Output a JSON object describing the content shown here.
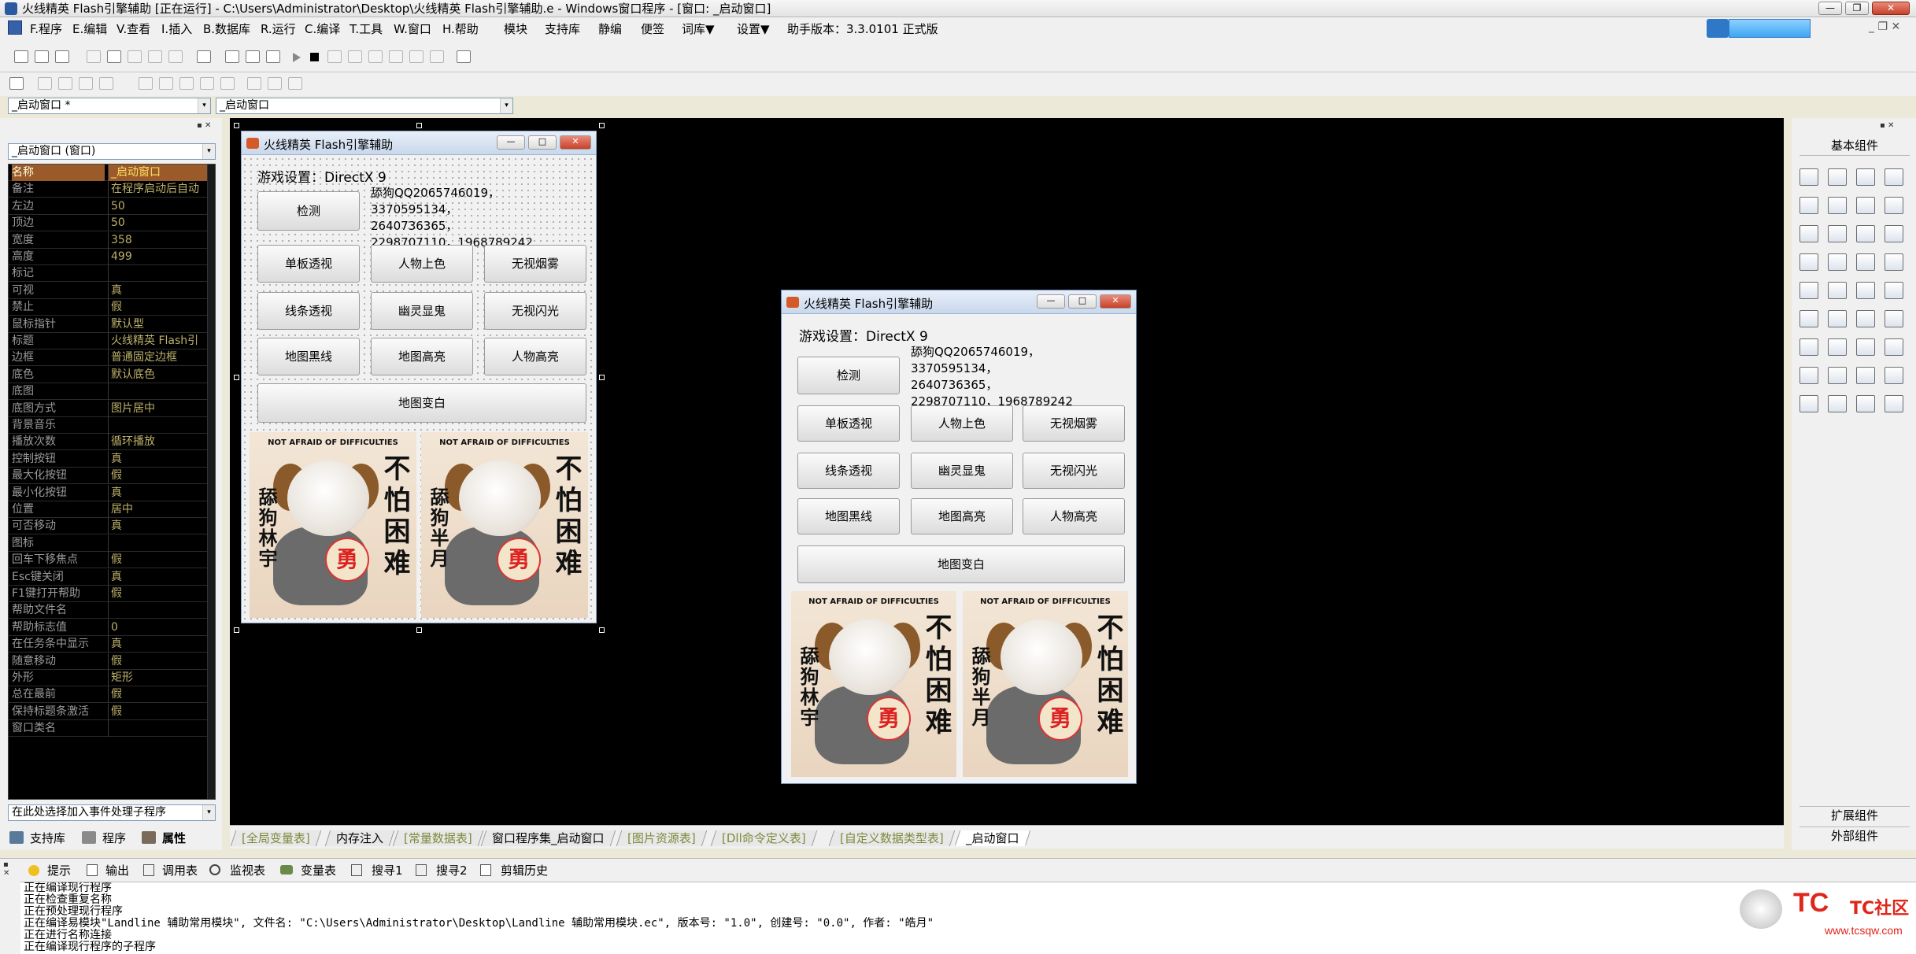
{
  "window": {
    "title": "火线精英 Flash引擎辅助 [正在运行] - C:\\Users\\Administrator\\Desktop\\火线精英 Flash引擎辅助.e - Windows窗口程序 - [窗口: _启动窗口]",
    "btn_min": "—",
    "btn_max": "❐",
    "btn_close": "✕"
  },
  "menu": [
    "F.程序",
    "E.编辑",
    "V.查看",
    "I.插入",
    "B.数据库",
    "R.运行",
    "C.编译",
    "T.工具",
    "W.窗口",
    "H.帮助",
    "模块",
    "支持库",
    "静编",
    "便签",
    "词库▼",
    "设置▼",
    "助手版本：3.3.0101 正式版"
  ],
  "toolbar": {
    "combo_window": "_启动窗口 *",
    "combo_sub": "_启动窗口",
    "dd_arrow": "▾"
  },
  "left_panel": {
    "combo_object": "_启动窗口 (窗口)",
    "properties": [
      {
        "k": "名称",
        "v": "_启动窗口"
      },
      {
        "k": "备注",
        "v": "在程序启动后自动"
      },
      {
        "k": "左边",
        "v": "50"
      },
      {
        "k": "顶边",
        "v": "50"
      },
      {
        "k": "宽度",
        "v": "358"
      },
      {
        "k": "高度",
        "v": "499"
      },
      {
        "k": "标记",
        "v": ""
      },
      {
        "k": "可视",
        "v": "真"
      },
      {
        "k": "禁止",
        "v": "假"
      },
      {
        "k": "鼠标指针",
        "v": "默认型"
      },
      {
        "k": "标题",
        "v": "火线精英 Flash引"
      },
      {
        "k": "边框",
        "v": "普通固定边框"
      },
      {
        "k": "底色",
        "v": "默认底色"
      },
      {
        "k": "底图",
        "v": ""
      },
      {
        "k": "  底图方式",
        "v": "图片居中"
      },
      {
        "k": "背景音乐",
        "v": ""
      },
      {
        "k": "  播放次数",
        "v": "循环播放"
      },
      {
        "k": "控制按钮",
        "v": "真"
      },
      {
        "k": "  最大化按钮",
        "v": "假"
      },
      {
        "k": "  最小化按钮",
        "v": "真"
      },
      {
        "k": "位置",
        "v": "居中"
      },
      {
        "k": "可否移动",
        "v": "真"
      },
      {
        "k": "图标",
        "v": ""
      },
      {
        "k": "回车下移焦点",
        "v": "假"
      },
      {
        "k": "Esc键关闭",
        "v": "真"
      },
      {
        "k": "F1键打开帮助",
        "v": "假"
      },
      {
        "k": "  帮助文件名",
        "v": ""
      },
      {
        "k": "  帮助标志值",
        "v": "0"
      },
      {
        "k": "在任务条中显示",
        "v": "真"
      },
      {
        "k": "随意移动",
        "v": "假"
      },
      {
        "k": "外形",
        "v": "矩形"
      },
      {
        "k": "总在最前",
        "v": "假"
      },
      {
        "k": "保持标题条激活",
        "v": "假"
      },
      {
        "k": "窗口类名",
        "v": ""
      }
    ],
    "event_combo": "在此处选择加入事件处理子程序",
    "bottom_tabs": [
      "支持库",
      "程序",
      "属性"
    ]
  },
  "app_window": {
    "caption": "火线精英 Flash引擎辅助",
    "game_setting": "游戏设置：DirectX 9",
    "qq_text": "舔狗QQ2065746019，3370595134，2640736365，2298707110，1968789242",
    "btn_detect": "检测",
    "buttons": [
      "单板透视",
      "人物上色",
      "无视烟雾",
      "线条透视",
      "幽灵显鬼",
      "无视闪光",
      "地图黑线",
      "地图高亮",
      "人物高亮"
    ],
    "btn_map_white": "地图变白",
    "img_arc": "NOT AFRAID OF DIFFICULTIES",
    "img_badge": "勇",
    "img_slogan": "不怕困难",
    "img_name_left": "舔狗林宇",
    "img_name_right": "舔狗半月",
    "btn_min": "—",
    "btn_max": "□",
    "btn_close": "✕"
  },
  "right_panel": {
    "title": "基本组件",
    "ext": "扩展组件",
    "external": "外部组件"
  },
  "editor_tabs": [
    "[全局变量表]",
    "内存注入",
    "[常量数据表]",
    "窗口程序集_启动窗口",
    "[图片资源表]",
    "[Dll命令定义表]",
    "[自定义数据类型表]",
    "_启动窗口"
  ],
  "output_tabs": [
    "提示",
    "输出",
    "调用表",
    "监视表",
    "变量表",
    "搜寻1",
    "搜寻2",
    "剪辑历史"
  ],
  "output_lines": [
    "正在编译现行程序",
    "正在检查重复名称",
    "正在预处理现行程序",
    "正在编译易模块\"Landline 辅助常用模块\", 文件名: \"C:\\Users\\Administrator\\Desktop\\Landline 辅助常用模块.ec\", 版本号: \"1.0\", 创建号: \"0.0\", 作者: \"皓月\"",
    "正在进行名称连接",
    "正在编译现行程序的子程序"
  ],
  "watermark": {
    "brand": "TC社区",
    "url": "www.tcsqw.com",
    "tag": "TC"
  },
  "colors": {
    "accent": "#316ac5",
    "prop_key": "#9a9a9a",
    "prop_val": "#bdb06a",
    "canvas": "#000000"
  }
}
